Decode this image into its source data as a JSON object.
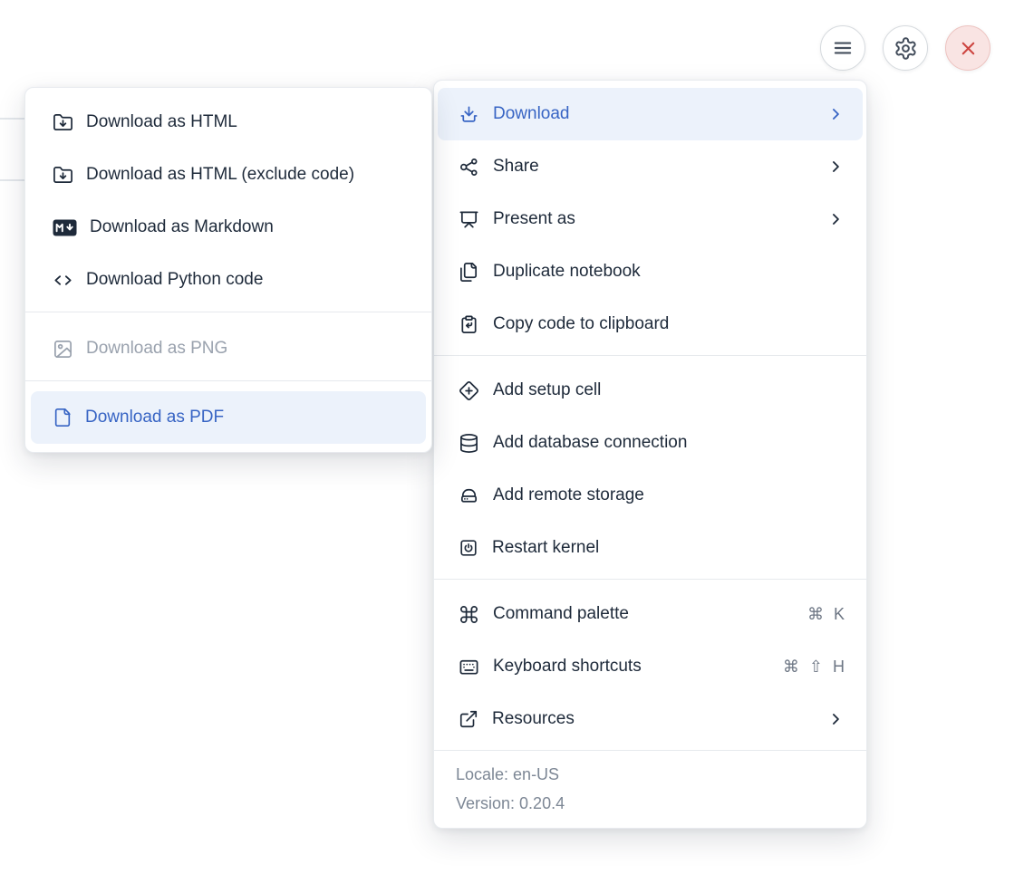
{
  "colors": {
    "accent_blue": "#3764c4",
    "highlight_bg": "#ecf2fb",
    "text_dark": "#1e2a3a",
    "text_muted": "#7d8795",
    "disabled_text": "#9aa2ae",
    "danger_red": "#cd4540",
    "close_button_bg": "#f9e4e3",
    "close_button_border": "#edc3c0"
  },
  "toolbar": {
    "buttons": [
      {
        "icon": "hamburger-menu-icon"
      },
      {
        "icon": "gear-icon"
      },
      {
        "icon": "close-x-icon"
      }
    ]
  },
  "submenu": {
    "items": [
      {
        "label": "Download as HTML",
        "icon": "folder-download-icon",
        "state": "normal"
      },
      {
        "label": "Download as HTML (exclude code)",
        "icon": "folder-download-icon",
        "state": "normal"
      },
      {
        "label": "Download as Markdown",
        "icon": "markdown-icon",
        "state": "normal"
      },
      {
        "label": "Download Python code",
        "icon": "code-icon",
        "state": "normal"
      },
      {
        "label": "Download as PNG",
        "icon": "image-icon",
        "state": "disabled"
      },
      {
        "label": "Download as PDF",
        "icon": "file-icon",
        "state": "highlighted"
      }
    ]
  },
  "menu": {
    "items": [
      {
        "label": "Download",
        "icon": "download-icon",
        "state": "highlighted",
        "has_submenu": true
      },
      {
        "label": "Share",
        "icon": "share-icon",
        "has_submenu": true
      },
      {
        "label": "Present as",
        "icon": "presentation-icon",
        "has_submenu": true
      },
      {
        "label": "Duplicate notebook",
        "icon": "duplicate-files-icon"
      },
      {
        "label": "Copy code to clipboard",
        "icon": "clipboard-copy-icon"
      },
      {
        "label": "Add setup cell",
        "icon": "diamond-plus-icon"
      },
      {
        "label": "Add database connection",
        "icon": "database-icon"
      },
      {
        "label": "Add remote storage",
        "icon": "remote-storage-icon"
      },
      {
        "label": "Restart kernel",
        "icon": "power-square-icon"
      },
      {
        "label": "Command palette",
        "icon": "command-icon",
        "shortcut": [
          "⌘",
          "K"
        ]
      },
      {
        "label": "Keyboard shortcuts",
        "icon": "keyboard-icon",
        "shortcut": [
          "⌘",
          "⇧",
          "H"
        ]
      },
      {
        "label": "Resources",
        "icon": "external-link-icon",
        "has_submenu": true
      }
    ],
    "footer": {
      "locale": "Locale: en-US",
      "version": "Version: 0.20.4"
    }
  }
}
